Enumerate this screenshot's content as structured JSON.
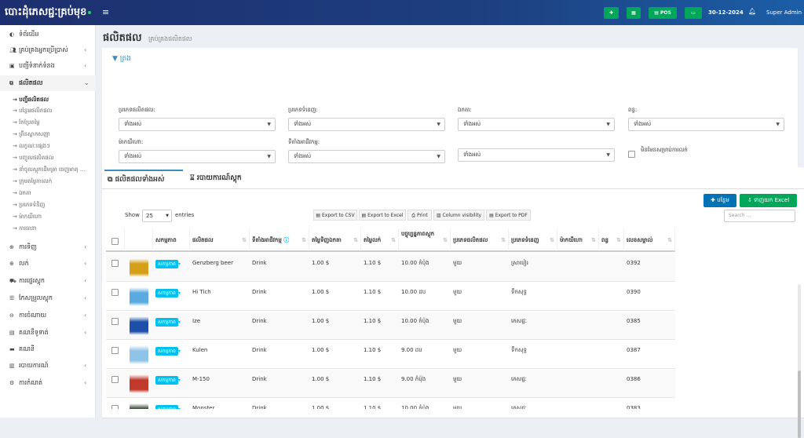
{
  "header": {
    "brand": "បោះដុំភេសជ្ជៈគ្រប់មុខ",
    "menu_icon": "bars-icon",
    "pos_label": "POS",
    "date": "30-12-2024",
    "user": "Super Admin"
  },
  "sidebar": {
    "items": [
      {
        "label": "ទំព័រដើម",
        "icon": "dashboard-icon"
      },
      {
        "label": "គ្រប់គ្រងអ្នកប្រើប្រាស់",
        "icon": "users-icon"
      },
      {
        "label": "បញ្ជីទំនាក់ទំនង",
        "icon": "contact-icon"
      },
      {
        "label": "ផលិតផល",
        "icon": "cubes-icon"
      },
      {
        "label": "ការទិញ",
        "icon": "download-icon"
      },
      {
        "label": "លក់",
        "icon": "upload-icon"
      },
      {
        "label": "ការផ្ទេរស្តុក",
        "icon": "truck-icon"
      },
      {
        "label": "កែសម្រួលស្តុក",
        "icon": "database-icon"
      },
      {
        "label": "ការចំណាយ",
        "icon": "minus-circle-icon"
      },
      {
        "label": "គណនីទូទាត់",
        "icon": "money-icon"
      },
      {
        "label": "គណនី",
        "icon": "book-icon"
      },
      {
        "label": "របាយការណ៍",
        "icon": "chart-icon"
      },
      {
        "label": "ការកំណត់",
        "icon": "cog-icon"
      }
    ],
    "submenu": [
      "→ បញ្ជីផលិតផល",
      "→ បន្ថែមផលិតផល",
      "→ កែប្រែតម្លៃ",
      "→ ព្រីនស្លាកសញ្ញា",
      "→ លក្ខណៈផ្សេងៗ",
      "→ បញ្ចូលផលិតផល",
      "→ នាំចូលស្តុកដើមគ្រា ចេញមាតុ ...",
      "→ ក្រុមតម្លៃការលក់",
      "→ ឯកតា",
      "→ ប្រភេទទំនិញ",
      "→ ម៉ាកយីហោ",
      "→ ការធានា"
    ]
  },
  "page": {
    "title": "ផលិតផល",
    "subtitle": "គ្រប់គ្រងផលិតផល"
  },
  "filters": {
    "header": "ត្រង",
    "product_type_label": "ប្រភេទផលិតផល:",
    "category_label": "ប្រភេទទំនេញ:",
    "unit_label": "ឯកតា:",
    "tax_label": "ពន្ធ:",
    "brand_label": "ម៉ាកយីហោ:",
    "location_label": "ទីតាំងអាជីវកម្ម:",
    "all": "ទាំងអស់",
    "not_for_sale_label": "មិនមែនសម្រាប់ការលក់"
  },
  "tabs": [
    {
      "label": "ផលិតផលទាំងអស់",
      "icon": "cubes-icon"
    },
    {
      "label": "របាយការណ៍ស្តុក",
      "icon": "hourglass-icon"
    }
  ],
  "actions": {
    "add": "បន្ថែម",
    "download_excel": "ទាញយក Excel"
  },
  "datatable": {
    "show": "Show",
    "length": "25",
    "entries": "entries",
    "export_csv": "Export to CSV",
    "export_excel": "Export to Excel",
    "print": "Print",
    "column_visibility": "Column visibility",
    "export_pdf": "Export to PDF",
    "search_placeholder": "Search ..."
  },
  "table": {
    "columns": [
      "",
      "",
      "សកម្មភាព",
      "ផលិតផល",
      "ទីតាំងអាជីវកម្ម",
      "តម្លៃទិញឯកតា",
      "តម្លៃលក់",
      "បច្ចុប្បន្នភាពស្តុក",
      "ប្រភេទផលិតផល",
      "ប្រភេទទំនេញ",
      "ម៉ាកយីហោ",
      "ពន្ធ",
      "លេខសម្គាល់"
    ],
    "action_label": "សកម្មភាព",
    "rows": [
      {
        "product": "Genzberg beer",
        "location": "Drink",
        "purchase": "1.00 $",
        "sell": "1.10 $",
        "stock": "10.00 កំប៉ុង",
        "type": "មួយ",
        "category": "ស្រាបៀរ",
        "brand": "",
        "tax": "",
        "sku": "0392",
        "thumb": "#d4a017"
      },
      {
        "product": "Hi Tich",
        "location": "Drink",
        "purchase": "1.00 $",
        "sell": "1.10 $",
        "stock": "10.00 ដប",
        "type": "មួយ",
        "category": "ទឹកសុទ្ធ",
        "brand": "",
        "tax": "",
        "sku": "0390",
        "thumb": "#5aaae0"
      },
      {
        "product": "Ize",
        "location": "Drink",
        "purchase": "1.00 $",
        "sell": "1.10 $",
        "stock": "10.00 កំប៉ុង",
        "type": "មួយ",
        "category": "ភេសជ្ជៈ",
        "brand": "",
        "tax": "",
        "sku": "0385",
        "thumb": "#1e4fa8"
      },
      {
        "product": "Kulen",
        "location": "Drink",
        "purchase": "1.00 $",
        "sell": "1.10 $",
        "stock": "9.00 ដប",
        "type": "មួយ",
        "category": "ទឹកសុទ្ធ",
        "brand": "",
        "tax": "",
        "sku": "0387",
        "thumb": "#8fc3e8"
      },
      {
        "product": "M-150",
        "location": "Drink",
        "purchase": "1.00 $",
        "sell": "1.10 $",
        "stock": "9.00 កំប៉ុង",
        "type": "មួយ",
        "category": "ភេសជ្ជៈ",
        "brand": "",
        "tax": "",
        "sku": "0386",
        "thumb": "#c0392b"
      },
      {
        "product": "Monster",
        "location": "Drink",
        "purchase": "1.00 $",
        "sell": "1.10 $",
        "stock": "10.00 កំប៉ុង",
        "type": "មួយ",
        "category": "ភេសជ្ជៈ",
        "brand": "",
        "tax": "",
        "sku": "0383",
        "thumb": "#2c3e2c"
      }
    ]
  },
  "colors": {
    "accent": "#3c8dbc",
    "green": "#00a65a",
    "badge": "#00c0ef",
    "primary": "#0073b7"
  }
}
